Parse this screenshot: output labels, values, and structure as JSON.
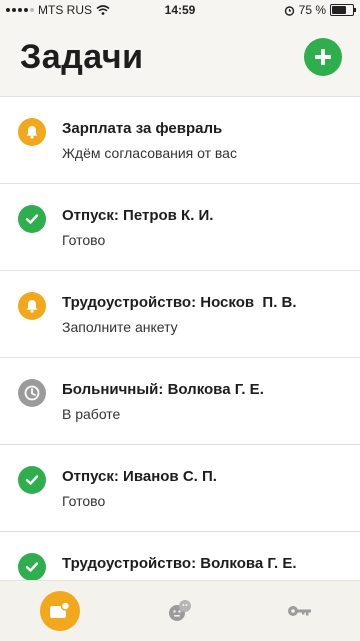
{
  "status_bar": {
    "carrier": "MTS RUS",
    "time": "14:59",
    "battery": "75 %",
    "battery_level": 0.75
  },
  "header": {
    "title": "Задачи",
    "add_icon": "plus-icon"
  },
  "colors": {
    "green": "#2fae4d",
    "orange": "#f2a81d",
    "gray": "#9b9b9b"
  },
  "tasks": [
    {
      "title": "Зарплата за февраль",
      "subtitle": "Ждём согласования от вас",
      "icon": "bell-icon",
      "color": "#f2a81d"
    },
    {
      "title": "Отпуск: Петров К. И.",
      "subtitle": "Готово",
      "icon": "check-icon",
      "color": "#2fae4d"
    },
    {
      "title": "Трудоустройство: Носков  П. В.",
      "subtitle": "Заполните анкету",
      "icon": "bell-icon",
      "color": "#f2a81d"
    },
    {
      "title": "Больничный: Волкова Г. Е.",
      "subtitle": "В работе",
      "icon": "clock-icon",
      "color": "#9b9b9b"
    },
    {
      "title": "Отпуск: Иванов С. П.",
      "subtitle": "Готово",
      "icon": "check-icon",
      "color": "#2fae4d"
    },
    {
      "title": "Трудоустройство: Волкова Г. Е.",
      "subtitle": "",
      "icon": "check-icon",
      "color": "#2fae4d"
    }
  ],
  "bottom_nav": [
    {
      "icon": "tasks-icon",
      "active": true
    },
    {
      "icon": "feedback-icon",
      "active": false
    },
    {
      "icon": "key-icon",
      "active": false
    }
  ]
}
